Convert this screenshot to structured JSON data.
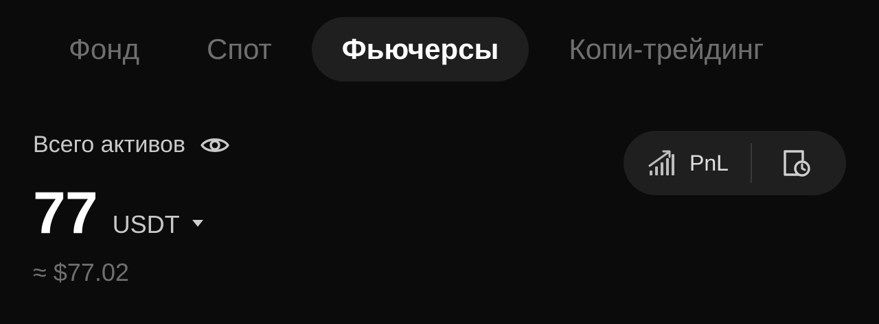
{
  "tabs": [
    {
      "label": "Фонд",
      "active": false
    },
    {
      "label": "Спот",
      "active": false
    },
    {
      "label": "Фьючерсы",
      "active": true
    },
    {
      "label": "Копи-трейдинг",
      "active": false
    }
  ],
  "assets": {
    "label": "Всего активов",
    "eye_icon": "eye-icon",
    "amount": "77",
    "currency": "USDT",
    "currency_icon": "caret-down-icon",
    "usd_equivalent": "≈ $77.02"
  },
  "pnl_pill": {
    "pnl_label": "PnL",
    "pnl_icon": "signal-bars-icon",
    "history_icon": "document-clock-icon"
  },
  "colors": {
    "background": "#0b0b0b",
    "pill": "#1f1f1f",
    "active_text": "#ffffff",
    "inactive_text": "#6f6f6f"
  }
}
